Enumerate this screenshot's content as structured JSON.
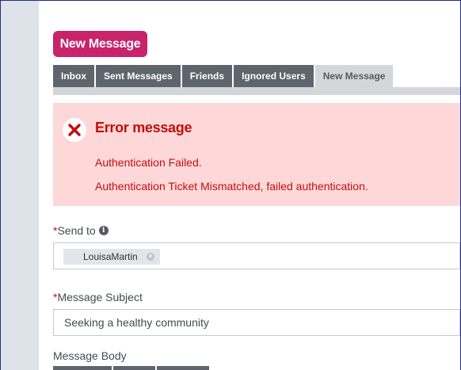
{
  "page": {
    "title_button": "New Message"
  },
  "tabs": [
    {
      "label": "Inbox"
    },
    {
      "label": "Sent Messages"
    },
    {
      "label": "Friends"
    },
    {
      "label": "Ignored Users"
    },
    {
      "label": "New Message"
    }
  ],
  "error": {
    "title": "Error message",
    "icon": "x-circle-icon",
    "lines": [
      "Authentication Failed.",
      "Authentication Ticket Mismatched, failed authentication."
    ],
    "color": "#c40d0d",
    "background": "#fed8d8"
  },
  "form": {
    "send_to": {
      "required_mark": "*",
      "label": "Send to",
      "recipients": [
        "LouisaMartin"
      ]
    },
    "subject": {
      "required_mark": "*",
      "label": "Message Subject",
      "value": "Seeking a healthy community"
    },
    "body": {
      "label": "Message Body"
    }
  },
  "colors": {
    "accent": "#c7246b",
    "tab": "#5f656d",
    "tab_active": "#d3d7da"
  }
}
